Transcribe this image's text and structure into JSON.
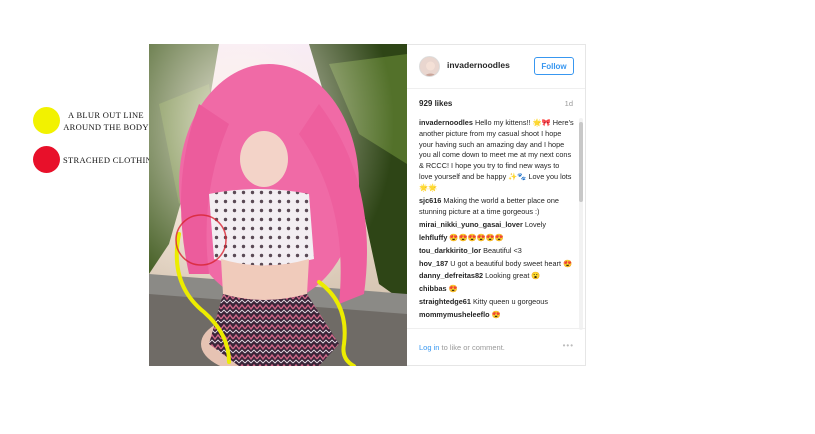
{
  "annotations": [
    {
      "label": "A BLUR OUT LINE AROUND THE BODY",
      "color": "#f2f200"
    },
    {
      "label": "STRACHED CLOTHING AND BODIES",
      "color": "#e8102a"
    }
  ],
  "colors": {
    "outline_yellow": "#ecec00",
    "circle_red": "#d8232f",
    "accent_blue": "#3897f0"
  },
  "post": {
    "username": "invadernoodles",
    "follow_label": "Follow",
    "likes": "929 likes",
    "age": "1d",
    "comments": [
      {
        "user": "invadernoodles",
        "text": "Hello my kittens!! 🌟🎀 Here's another picture from my casual shoot I hope your having such an amazing day and I hope you all come down to meet me at my next cons & RCCC! I hope you try to find new ways to love yourself and be happy ✨🐾 Love you lots 🌟🌟"
      },
      {
        "user": "sjc616",
        "text": "Making the world a better place one stunning picture at a time gorgeous :)"
      },
      {
        "user": "mirai_nikki_yuno_gasai_lover",
        "text": "Lovely"
      },
      {
        "user": "lehfluffy",
        "text": "😍😍😍😍😍😍"
      },
      {
        "user": "tou_darkkirito_lor",
        "text": "Beautiful <3"
      },
      {
        "user": "hov_187",
        "text": "U got a beautiful body sweet heart 😍"
      },
      {
        "user": "danny_defreitas82",
        "text": "Looking great 😮"
      },
      {
        "user": "chibbas",
        "text": "😍"
      },
      {
        "user": "straightedge61",
        "text": "Kitty queen u gorgeous"
      },
      {
        "user": "mommymusheleeflo",
        "text": "😍"
      }
    ],
    "login_link": "Log in",
    "login_suffix": " to like or comment.",
    "more_label": "•••"
  }
}
